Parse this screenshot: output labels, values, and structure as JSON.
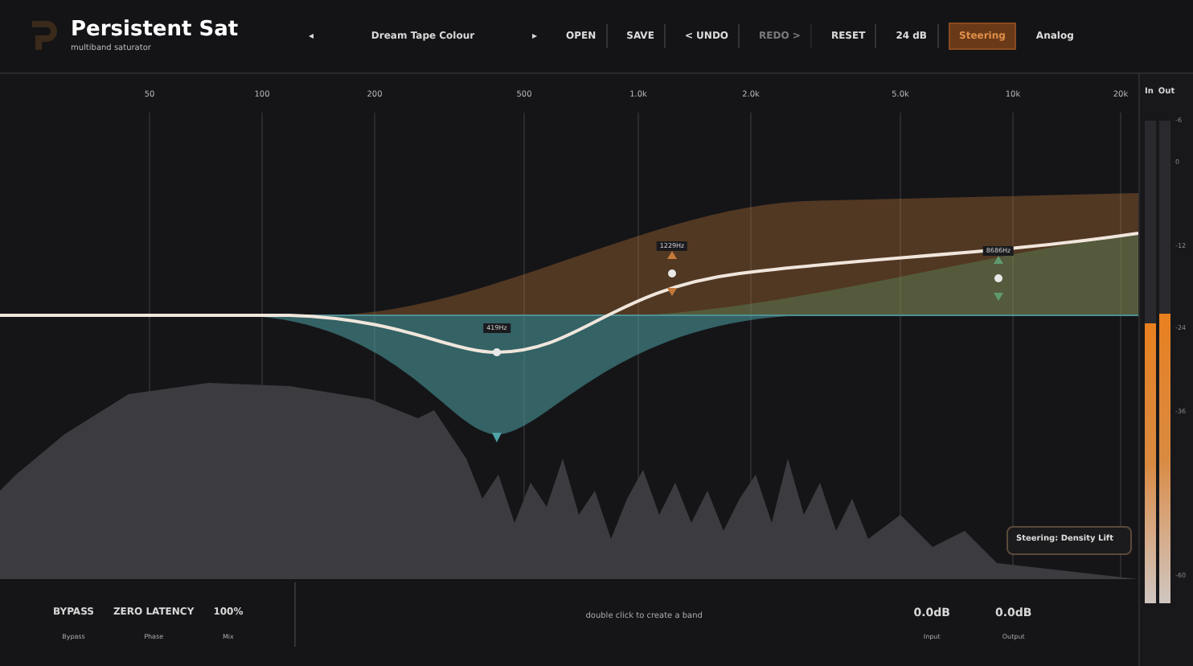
{
  "header": {
    "title": "Persistent Sat",
    "subtitle": "multiband saturator",
    "preset": {
      "prev": "◂",
      "name": "Dream Tape Colour",
      "next": "▸"
    },
    "buttons": [
      {
        "label": "OPEN",
        "disabled": false,
        "selected": false
      },
      {
        "label": "SAVE",
        "disabled": false,
        "selected": false
      },
      {
        "label": "< UNDO",
        "disabled": false,
        "selected": false
      },
      {
        "label": "REDO >",
        "disabled": true,
        "selected": false
      },
      {
        "label": "RESET",
        "disabled": false,
        "selected": false
      },
      {
        "label": "24 dB",
        "disabled": false,
        "selected": false
      },
      {
        "label": "Steering",
        "disabled": false,
        "selected": true
      },
      {
        "label": "Analog",
        "disabled": false,
        "selected": false
      }
    ]
  },
  "frequency_axis": [
    "50",
    "100",
    "200",
    "500",
    "1.0k",
    "2.0k",
    "5.0k",
    "10k",
    "20k"
  ],
  "bands": [
    {
      "label": "419Hz",
      "color": "#4fa3a5"
    },
    {
      "label": "1229Hz",
      "color": "#c47a3a"
    },
    {
      "label": "8686Hz",
      "color": "#5f9a6e"
    }
  ],
  "tooltip": "Steering: Density Lift",
  "controls": [
    {
      "value": "BYPASS",
      "label": "Bypass"
    },
    {
      "value": "ZERO LATENCY",
      "label": "Phase"
    },
    {
      "value": "100%",
      "label": "Mix"
    }
  ],
  "hint": "double click to create a band",
  "readouts": [
    {
      "value": "0.0dB",
      "label": "Input"
    },
    {
      "value": "0.0dB",
      "label": "Output"
    }
  ],
  "meters": {
    "labels": [
      "In",
      "Out"
    ],
    "levels": [
      {
        "level": 0.58
      },
      {
        "level": 0.6
      }
    ],
    "scale": [
      "-6",
      "0",
      "-12",
      "-24",
      "-36",
      "-60"
    ]
  }
}
